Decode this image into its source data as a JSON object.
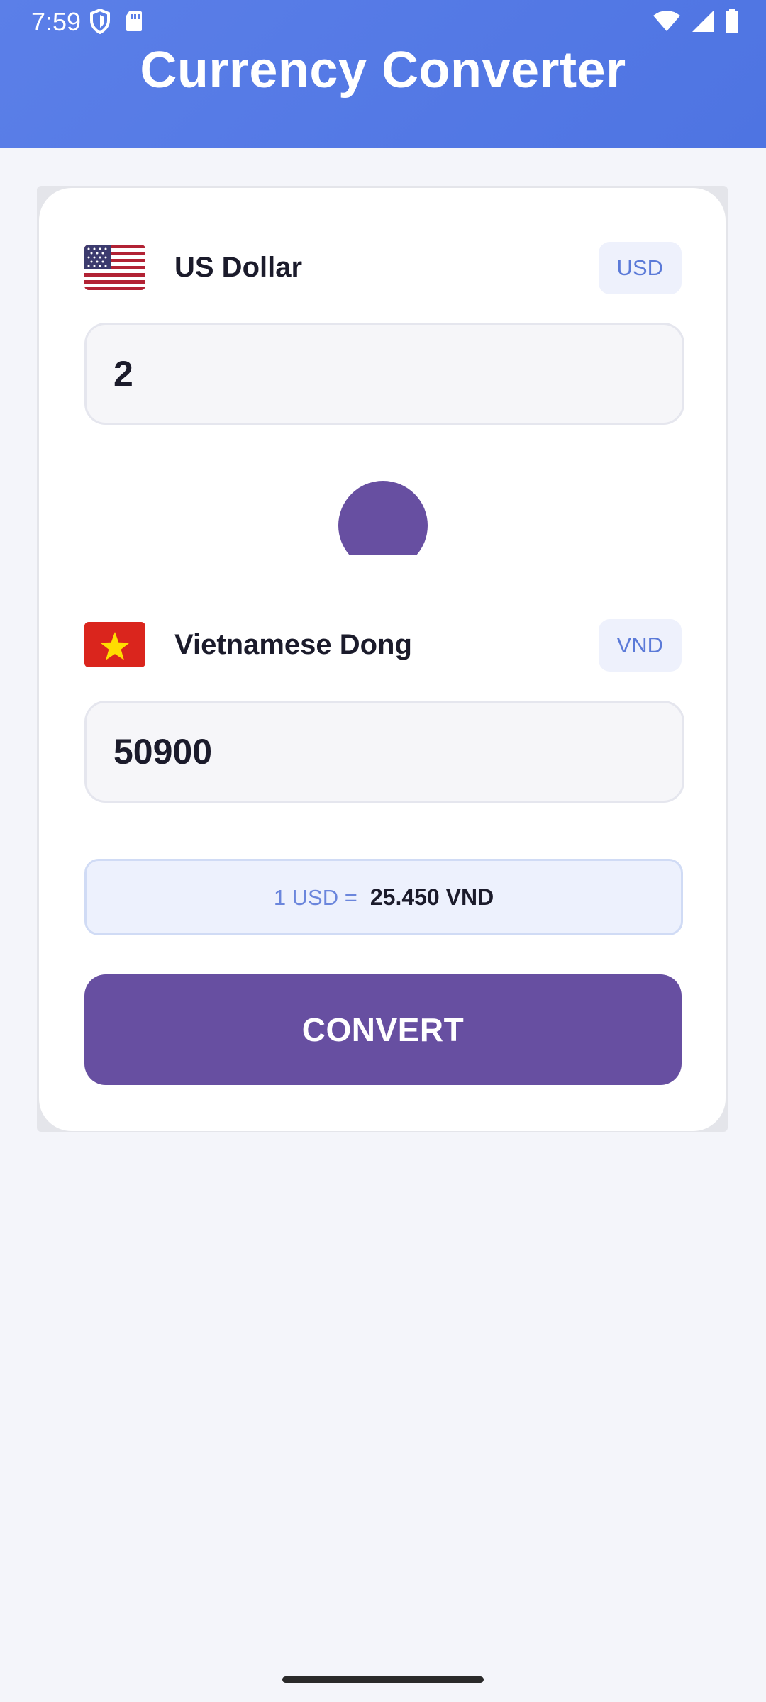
{
  "status_bar": {
    "time": "7:59",
    "left_icons": [
      "shield-icon",
      "sim-card-icon"
    ],
    "right_icons": [
      "wifi-icon",
      "signal-icon",
      "battery-icon"
    ]
  },
  "header": {
    "title": "Currency Converter",
    "color": "#5b7fe8"
  },
  "from_currency": {
    "flag_icon": "us-flag-icon",
    "name": "US Dollar",
    "code": "USD",
    "amount": "2"
  },
  "swap": {
    "icon": "swap-icon",
    "color": "#674fa1"
  },
  "to_currency": {
    "flag_icon": "vietnam-flag-icon",
    "name": "Vietnamese Dong",
    "code": "VND",
    "amount": "50900"
  },
  "rate": {
    "prefix": "1 USD =",
    "value": "25.450 VND"
  },
  "convert_button": {
    "label": "CONVERT",
    "color": "#674fa1"
  }
}
